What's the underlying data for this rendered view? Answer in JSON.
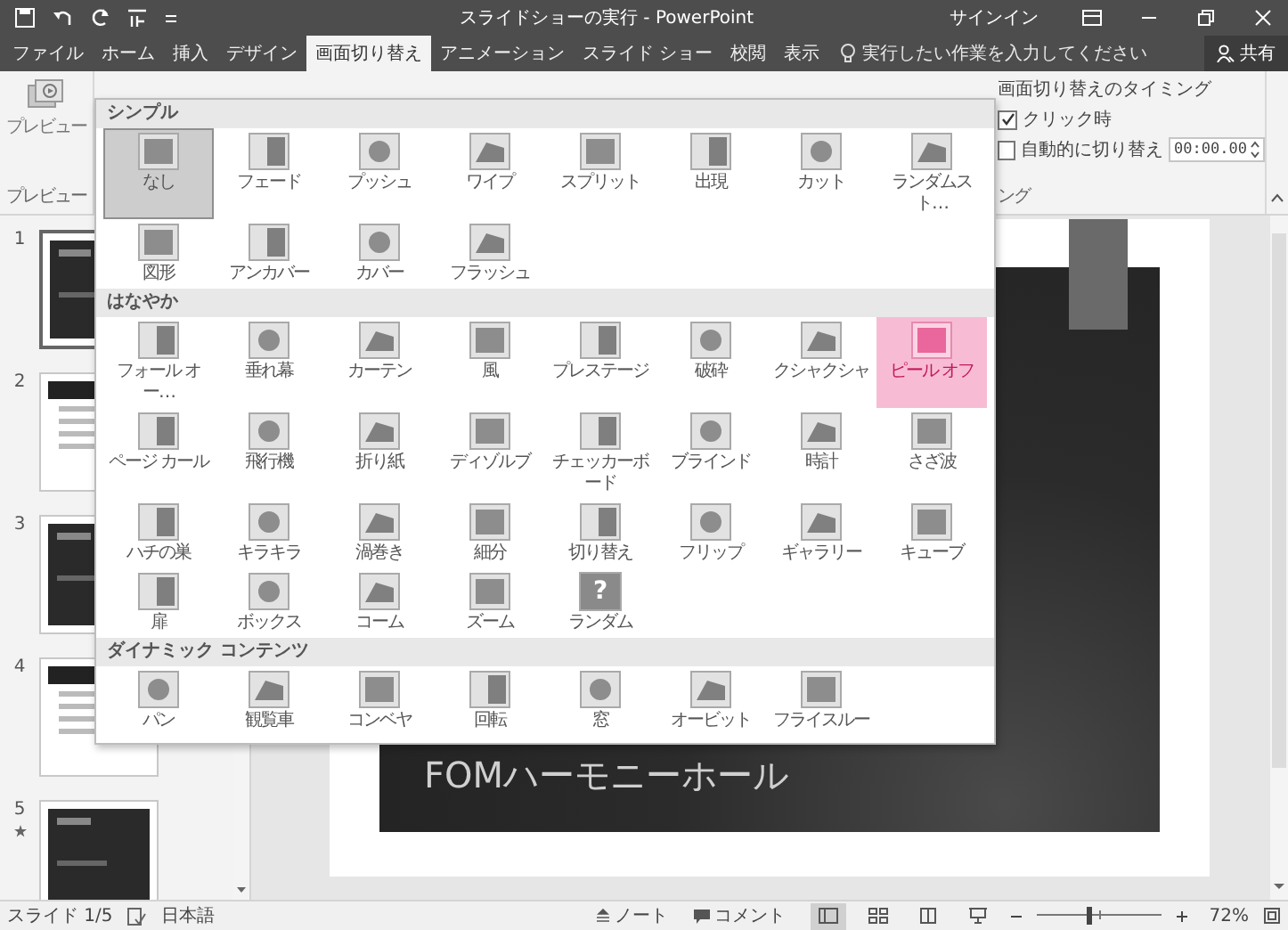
{
  "title_bar": {
    "title": "スライドショーの実行 - PowerPoint",
    "sign_in": "サインイン"
  },
  "tabs": [
    {
      "label": "ファイル",
      "selected": false
    },
    {
      "label": "ホーム",
      "selected": false
    },
    {
      "label": "挿入",
      "selected": false
    },
    {
      "label": "デザイン",
      "selected": false
    },
    {
      "label": "画面切り替え",
      "selected": true
    },
    {
      "label": "アニメーション",
      "selected": false
    },
    {
      "label": "スライド ショー",
      "selected": false
    },
    {
      "label": "校閲",
      "selected": false
    },
    {
      "label": "表示",
      "selected": false
    }
  ],
  "tell_me": {
    "placeholder": "実行したい作業を入力してください"
  },
  "share": "共有",
  "ribbon": {
    "preview_button": "プレビュー",
    "preview_group": "プレビュー",
    "timing": {
      "title": "画面切り替えのタイミング",
      "on_click": {
        "label": "クリック時",
        "checked": true
      },
      "after": {
        "label": "自動的に切り替え",
        "checked": false,
        "value": "00:00.00"
      },
      "group_label": "ング"
    }
  },
  "gallery": {
    "sections": [
      {
        "title": "シンプル",
        "items": [
          {
            "label": "なし",
            "selected": true,
            "hovered": false
          },
          {
            "label": "フェード",
            "selected": false,
            "hovered": false
          },
          {
            "label": "プッシュ",
            "selected": false,
            "hovered": false
          },
          {
            "label": "ワイプ",
            "selected": false,
            "hovered": false
          },
          {
            "label": "スプリット",
            "selected": false,
            "hovered": false
          },
          {
            "label": "出現",
            "selected": false,
            "hovered": false
          },
          {
            "label": "カット",
            "selected": false,
            "hovered": false
          },
          {
            "label": "ランダムスト…",
            "selected": false,
            "hovered": false
          },
          {
            "label": "図形",
            "selected": false,
            "hovered": false
          },
          {
            "label": "アンカバー",
            "selected": false,
            "hovered": false
          },
          {
            "label": "カバー",
            "selected": false,
            "hovered": false
          },
          {
            "label": "フラッシュ",
            "selected": false,
            "hovered": false
          }
        ]
      },
      {
        "title": "はなやか",
        "items": [
          {
            "label": "フォール オー…",
            "selected": false,
            "hovered": false
          },
          {
            "label": "垂れ幕",
            "selected": false,
            "hovered": false
          },
          {
            "label": "カーテン",
            "selected": false,
            "hovered": false
          },
          {
            "label": "風",
            "selected": false,
            "hovered": false
          },
          {
            "label": "プレステージ",
            "selected": false,
            "hovered": false
          },
          {
            "label": "破砕",
            "selected": false,
            "hovered": false
          },
          {
            "label": "クシャクシャ",
            "selected": false,
            "hovered": false
          },
          {
            "label": "ピール オフ",
            "selected": false,
            "hovered": true
          },
          {
            "label": "ページ カール",
            "selected": false,
            "hovered": false
          },
          {
            "label": "飛行機",
            "selected": false,
            "hovered": false
          },
          {
            "label": "折り紙",
            "selected": false,
            "hovered": false
          },
          {
            "label": "ディゾルブ",
            "selected": false,
            "hovered": false
          },
          {
            "label": "チェッカーボード",
            "selected": false,
            "hovered": false
          },
          {
            "label": "ブラインド",
            "selected": false,
            "hovered": false
          },
          {
            "label": "時計",
            "selected": false,
            "hovered": false
          },
          {
            "label": "さざ波",
            "selected": false,
            "hovered": false
          },
          {
            "label": "ハチの巣",
            "selected": false,
            "hovered": false
          },
          {
            "label": "キラキラ",
            "selected": false,
            "hovered": false
          },
          {
            "label": "渦巻き",
            "selected": false,
            "hovered": false
          },
          {
            "label": "細分",
            "selected": false,
            "hovered": false
          },
          {
            "label": "切り替え",
            "selected": false,
            "hovered": false
          },
          {
            "label": "フリップ",
            "selected": false,
            "hovered": false
          },
          {
            "label": "ギャラリー",
            "selected": false,
            "hovered": false
          },
          {
            "label": "キューブ",
            "selected": false,
            "hovered": false
          },
          {
            "label": "扉",
            "selected": false,
            "hovered": false
          },
          {
            "label": "ボックス",
            "selected": false,
            "hovered": false
          },
          {
            "label": "コーム",
            "selected": false,
            "hovered": false
          },
          {
            "label": "ズーム",
            "selected": false,
            "hovered": false
          },
          {
            "label": "ランダム",
            "selected": false,
            "hovered": false,
            "glyph": "?"
          }
        ]
      },
      {
        "title": "ダイナミック コンテンツ",
        "items": [
          {
            "label": "パン",
            "selected": false,
            "hovered": false
          },
          {
            "label": "観覧車",
            "selected": false,
            "hovered": false
          },
          {
            "label": "コンベヤ",
            "selected": false,
            "hovered": false
          },
          {
            "label": "回転",
            "selected": false,
            "hovered": false
          },
          {
            "label": "窓",
            "selected": false,
            "hovered": false
          },
          {
            "label": "オービット",
            "selected": false,
            "hovered": false
          },
          {
            "label": "フライスルー",
            "selected": false,
            "hovered": false
          }
        ]
      }
    ]
  },
  "slides": [
    {
      "number": "1",
      "selected": true,
      "animated": false
    },
    {
      "number": "2",
      "selected": false,
      "animated": false
    },
    {
      "number": "3",
      "selected": false,
      "animated": false
    },
    {
      "number": "4",
      "selected": false,
      "animated": false
    },
    {
      "number": "5",
      "selected": false,
      "animated": true
    }
  ],
  "slide": {
    "title": "FOMハーモニーホール"
  },
  "status_bar": {
    "slide_count": "スライド 1/5",
    "language": "日本語",
    "notes": "ノート",
    "comments": "コメント",
    "views": [
      {
        "kind": "normal",
        "selected": true
      },
      {
        "kind": "sorter",
        "selected": false
      },
      {
        "kind": "reading",
        "selected": false
      },
      {
        "kind": "slideshow",
        "selected": false
      }
    ],
    "zoom_slider": {
      "level": 0.42
    },
    "zoom": "72%"
  }
}
